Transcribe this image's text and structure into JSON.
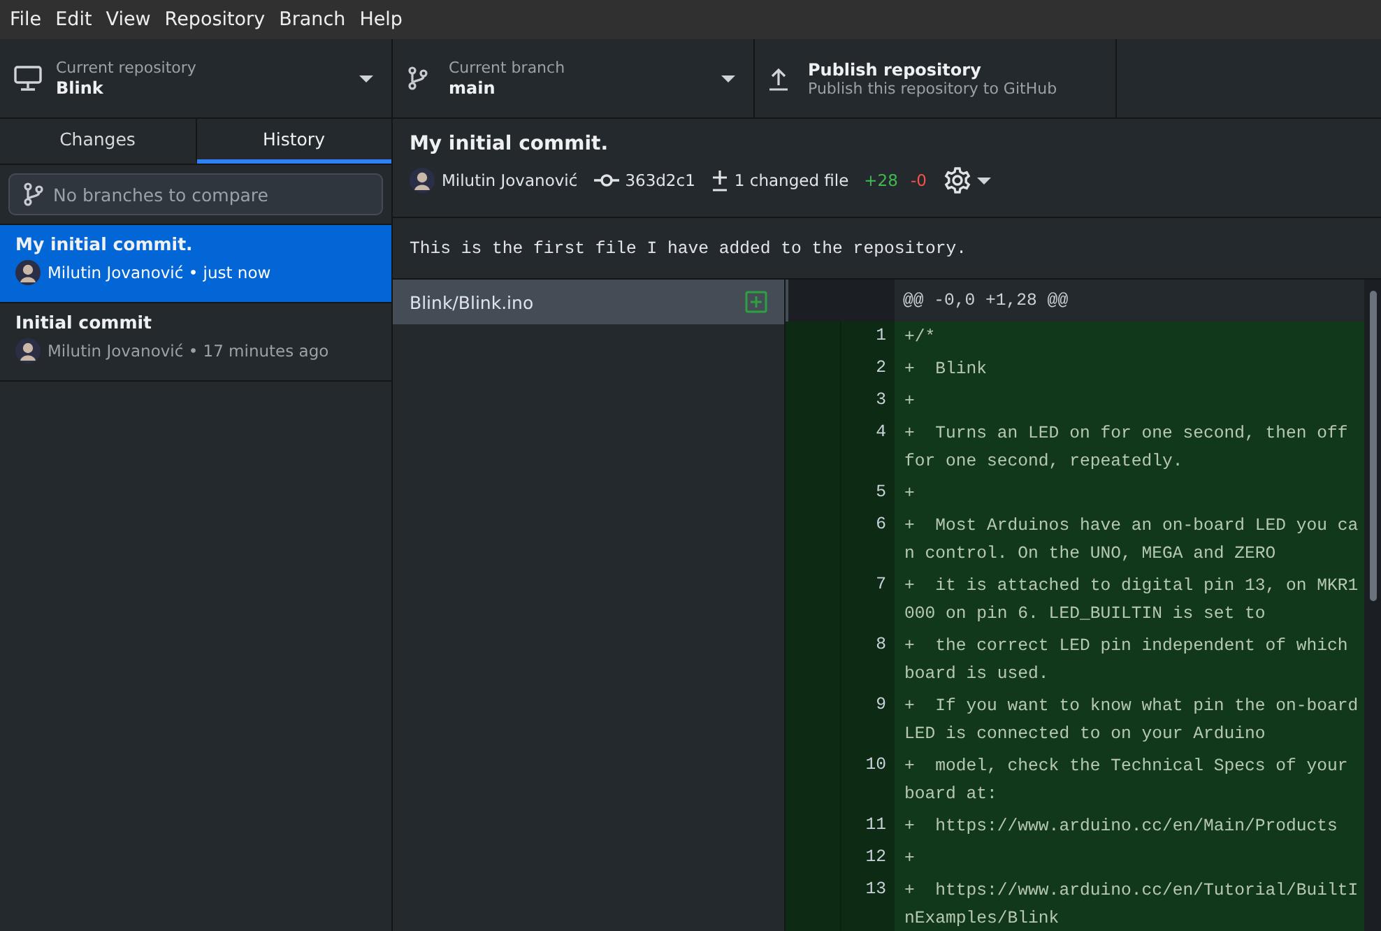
{
  "menu": [
    "File",
    "Edit",
    "View",
    "Repository",
    "Branch",
    "Help"
  ],
  "toolbar": {
    "repository": {
      "label": "Current repository",
      "value": "Blink"
    },
    "branch": {
      "label": "Current branch",
      "value": "main"
    },
    "publish": {
      "title": "Publish repository",
      "subtitle": "Publish this repository to GitHub"
    }
  },
  "sidebar": {
    "tabs": [
      {
        "label": "Changes",
        "selected": false
      },
      {
        "label": "History",
        "selected": true
      }
    ],
    "compare_field": {
      "placeholder": "No branches to compare"
    },
    "commits": [
      {
        "title": "My initial commit.",
        "meta": "Milutin Jovanović • just now",
        "selected": true
      },
      {
        "title": "Initial commit",
        "meta": "Milutin Jovanović • 17 minutes ago",
        "selected": false
      }
    ]
  },
  "commit": {
    "title": "My initial commit.",
    "author": "Milutin Jovanović",
    "sha": "363d2c1",
    "changed_files": "1 changed file",
    "additions": "+28",
    "deletions": "-0",
    "description": "This is the first file I have added to the repository."
  },
  "files": [
    {
      "path": "Blink/Blink.ino",
      "selected": true,
      "kind": "added"
    }
  ],
  "diff": {
    "hunk_header": "@@ -0,0 +1,28 @@",
    "lines": [
      {
        "number": "1",
        "text": "+/*"
      },
      {
        "number": "2",
        "text": "+  Blink"
      },
      {
        "number": "3",
        "text": "+"
      },
      {
        "number": "4",
        "text": "+  Turns an LED on for one second, then off for one second, repeatedly."
      },
      {
        "number": "5",
        "text": "+"
      },
      {
        "number": "6",
        "text": "+  Most Arduinos have an on-board LED you can control. On the UNO, MEGA and ZERO"
      },
      {
        "number": "7",
        "text": "+  it is attached to digital pin 13, on MKR1000 on pin 6. LED_BUILTIN is set to"
      },
      {
        "number": "8",
        "text": "+  the correct LED pin independent of which board is used."
      },
      {
        "number": "9",
        "text": "+  If you want to know what pin the on-board LED is connected to on your Arduino"
      },
      {
        "number": "10",
        "text": "+  model, check the Technical Specs of your board at:"
      },
      {
        "number": "11",
        "text": "+  https://www.arduino.cc/en/Main/Products"
      },
      {
        "number": "12",
        "text": "+"
      },
      {
        "number": "13",
        "text": "+  https://www.arduino.cc/en/Tutorial/BuiltInExamples/Blink"
      }
    ]
  }
}
